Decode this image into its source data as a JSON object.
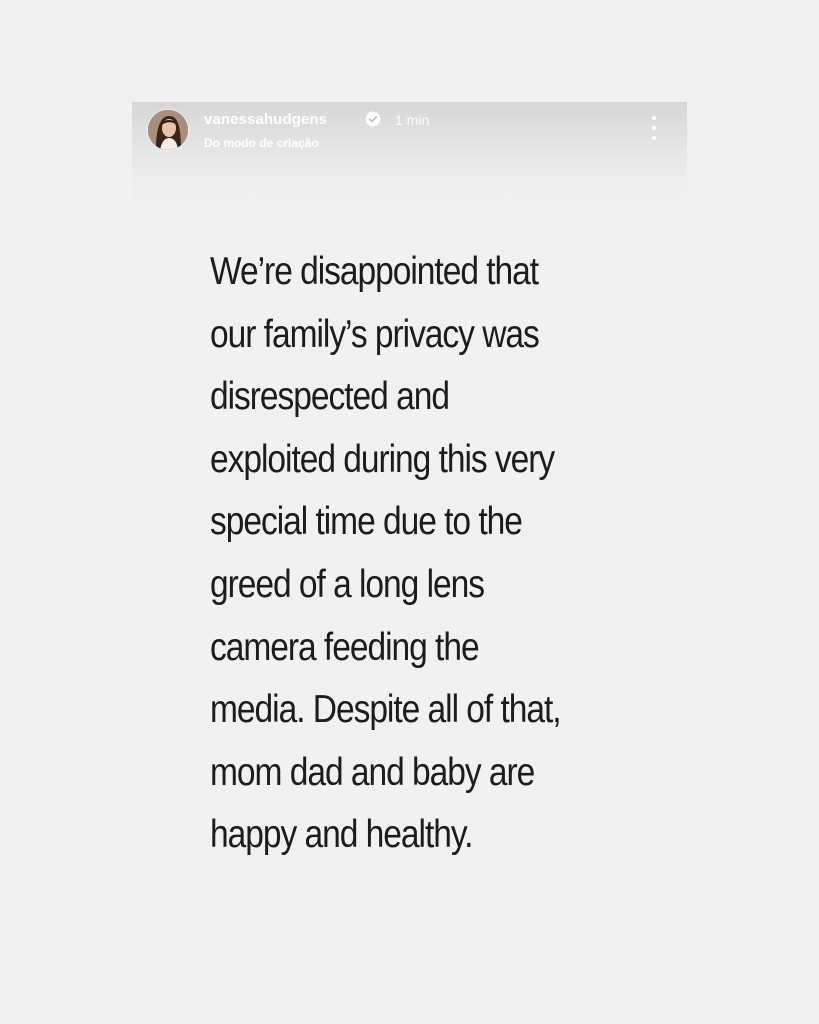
{
  "story": {
    "header": {
      "username": "vanessahudgens",
      "timestamp": "1 min",
      "subtitle": "Do modo de criação",
      "verified_icon": "verified-badge-icon",
      "menu_icon": "more-vertical-icon"
    },
    "message_lines": [
      "We’re disappointed that",
      "our family’s privacy was",
      "disrespected and",
      "exploited during this very",
      "special time due to the",
      "greed of a long lens",
      "camera feeding the",
      "media. Despite all of that,",
      "mom dad and baby are",
      "happy and healthy."
    ]
  },
  "colors": {
    "background": "#f1f1f1",
    "text": "#1c1c1c",
    "header_text": "#ffffff"
  }
}
